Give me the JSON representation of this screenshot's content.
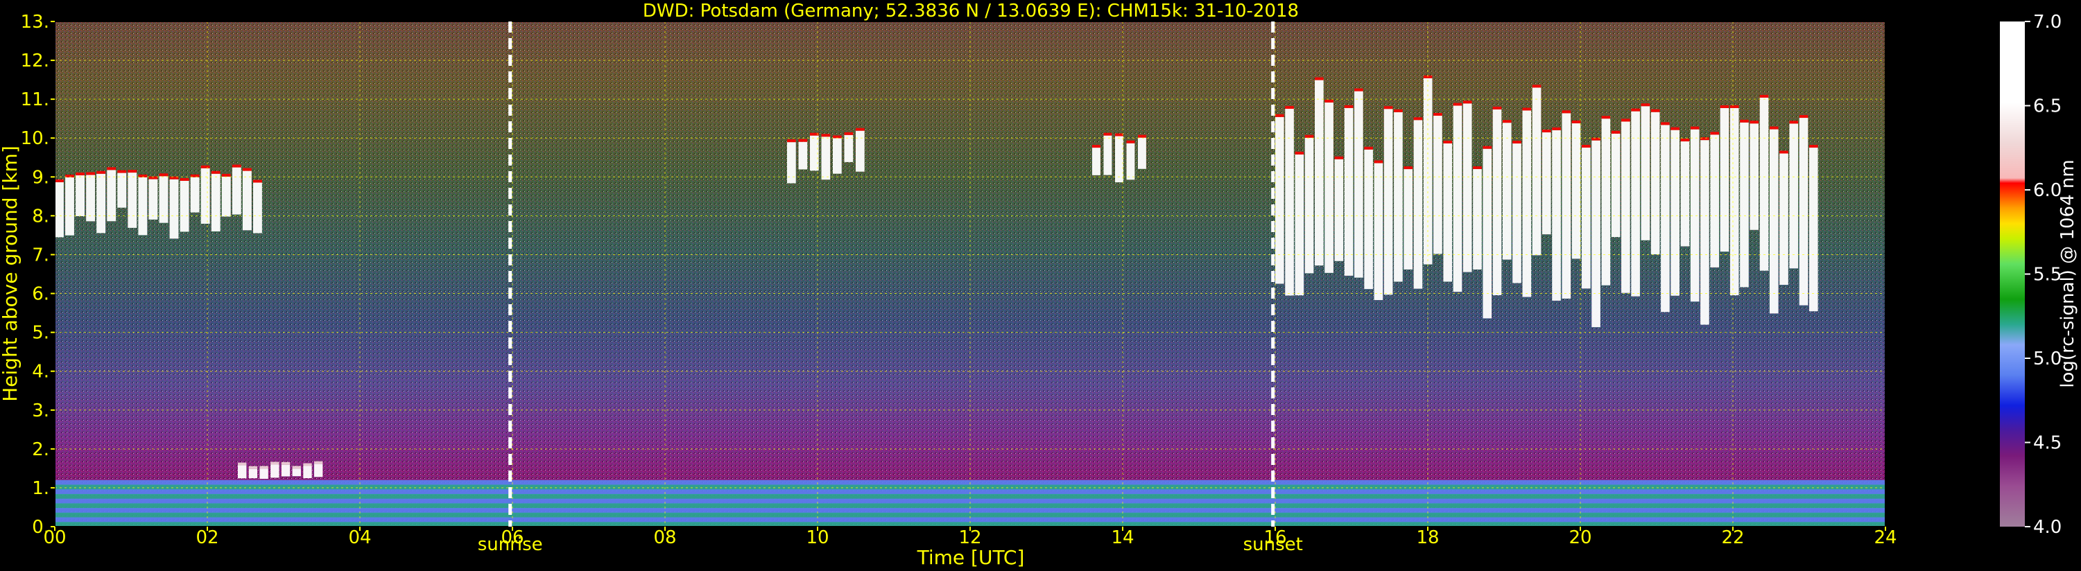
{
  "chart_data": {
    "type": "heatmap",
    "title": "DWD: Potsdam (Germany; 52.3836 N / 13.0639 E):    CHM15k: 31-10-2018",
    "xlabel": "Time [UTC]",
    "ylabel": "Height above ground [km]",
    "xlim": [
      0,
      24
    ],
    "ylim": [
      0,
      13
    ],
    "x_ticks": [
      "00",
      "02",
      "04",
      "06",
      "08",
      "10",
      "12",
      "14",
      "16",
      "18",
      "20",
      "22",
      "24"
    ],
    "y_ticks": [
      "0.",
      "1.",
      "2.",
      "3.",
      "4.",
      "5.",
      "6.",
      "7.",
      "8.",
      "9.",
      "10.",
      "11.",
      "12.",
      "13."
    ],
    "grid": true,
    "markers": [
      {
        "label": "sunrise",
        "x": 5.97
      },
      {
        "label": "sunset",
        "x": 15.97
      }
    ],
    "colorbar": {
      "label": "log(rc-signal) @ 1064 nm",
      "ticks": [
        "4.0",
        "4.5",
        "5.0",
        "5.5",
        "6.0",
        "6.5",
        "7.0"
      ],
      "min": 4.0,
      "max": 7.0
    },
    "features": [
      {
        "name": "aerosol boundary layer",
        "x": [
          0,
          24
        ],
        "height_km": [
          0,
          1.2
        ],
        "value_range": [
          4.8,
          5.3
        ]
      },
      {
        "name": "cirrus clouds",
        "x": [
          0,
          2.6
        ],
        "height_km": [
          7.5,
          9.3
        ],
        "value_range": [
          6.0,
          7.0
        ]
      },
      {
        "name": "cirrus clouds",
        "x": [
          9.6,
          10.5
        ],
        "height_km": [
          8.9,
          10.2
        ],
        "value_range": [
          6.0,
          7.0
        ]
      },
      {
        "name": "cirrus clouds",
        "x": [
          13.6,
          14.2
        ],
        "height_km": [
          8.8,
          10.2
        ],
        "value_range": [
          6.0,
          7.0
        ]
      },
      {
        "name": "cirrus clouds",
        "x": [
          16.0,
          23.0
        ],
        "height_km": [
          5.5,
          11.2
        ],
        "value_range": [
          6.0,
          7.0
        ]
      },
      {
        "name": "low cloud",
        "x": [
          2.4,
          3.4
        ],
        "height_km": [
          1.2,
          1.6
        ],
        "value_range": [
          6.5,
          7.0
        ]
      }
    ]
  }
}
